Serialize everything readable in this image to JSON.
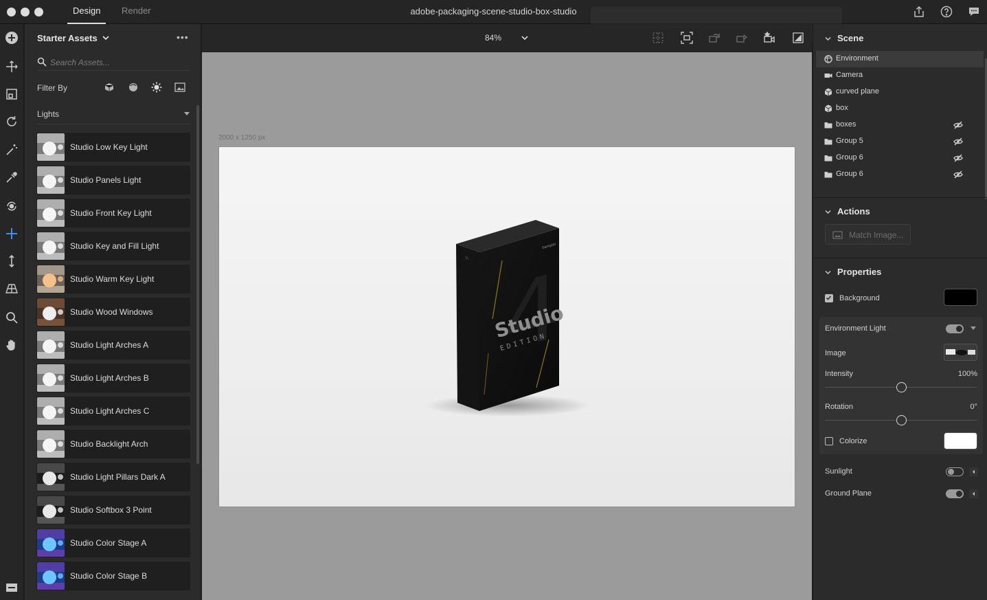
{
  "title_bar": {
    "tabs": [
      "Design",
      "Render"
    ],
    "document_title": "adobe-packaging-scene-studio-box-studio",
    "icons": [
      "share-icon",
      "help-icon",
      "feedback-icon"
    ]
  },
  "tools": [
    "add-icon",
    "move-icon",
    "frame-icon",
    "rotate-icon",
    "magic-wand-icon",
    "eyedropper-icon",
    "orbit-icon",
    "crosshair-move-icon",
    "vertical-move-icon",
    "perspective-icon",
    "zoom-icon",
    "hand-icon",
    "panel-toggle-icon"
  ],
  "assets": {
    "header": "Starter Assets",
    "more": "•••",
    "search_placeholder": "Search Assets...",
    "filter_label": "Filter By",
    "category": "Lights",
    "items": [
      {
        "label": "Studio Low Key Light",
        "thumb": "gray"
      },
      {
        "label": "Studio Panels Light",
        "thumb": "gray"
      },
      {
        "label": "Studio Front Key Light",
        "thumb": "gray"
      },
      {
        "label": "Studio Key and Fill Light",
        "thumb": "gray"
      },
      {
        "label": "Studio Warm Key Light",
        "thumb": "warm"
      },
      {
        "label": "Studio Wood Windows",
        "thumb": "wood"
      },
      {
        "label": "Studio Light Arches A",
        "thumb": "gray"
      },
      {
        "label": "Studio Light Arches B",
        "thumb": "gray"
      },
      {
        "label": "Studio Light Arches C",
        "thumb": "gray"
      },
      {
        "label": "Studio Backlight Arch",
        "thumb": "gray"
      },
      {
        "label": "Studio Light Pillars Dark A",
        "thumb": "dark"
      },
      {
        "label": "Studio Softbox 3 Point",
        "thumb": "dark"
      },
      {
        "label": "Studio Color Stage A",
        "thumb": "color"
      },
      {
        "label": "Studio Color Stage B",
        "thumb": "color"
      }
    ]
  },
  "canvas": {
    "zoom": "84%",
    "dimensions": "2000 x 1250 px",
    "box_text": {
      "brand": "Sampler",
      "headline": "Studio",
      "subline": "EDITION",
      "spine": "SL",
      "big_numeral": "4"
    }
  },
  "scene": {
    "header": "Scene",
    "layers": [
      {
        "label": "Environment",
        "icon": "environment-icon",
        "hidden": false,
        "selected": true
      },
      {
        "label": "Camera",
        "icon": "camera-icon",
        "hidden": false,
        "selected": false
      },
      {
        "label": "curved plane",
        "icon": "model-icon",
        "hidden": false,
        "selected": false
      },
      {
        "label": "box",
        "icon": "model-icon",
        "hidden": false,
        "selected": false
      },
      {
        "label": "boxes",
        "icon": "folder-icon",
        "hidden": true,
        "selected": false
      },
      {
        "label": "Group 5",
        "icon": "folder-icon",
        "hidden": true,
        "selected": false
      },
      {
        "label": "Group 6",
        "icon": "folder-icon",
        "hidden": true,
        "selected": false
      },
      {
        "label": "Group 6",
        "icon": "folder-icon",
        "hidden": true,
        "selected": false
      }
    ]
  },
  "actions": {
    "header": "Actions",
    "match_image": "Match Image..."
  },
  "properties": {
    "header": "Properties",
    "background_label": "Background",
    "background_checked": true,
    "background_color": "#000000",
    "env_light_label": "Environment Light",
    "env_light_on": true,
    "image_label": "Image",
    "intensity_label": "Intensity",
    "intensity_value": "100%",
    "intensity_fraction": 0.5,
    "rotation_label": "Rotation",
    "rotation_value": "0°",
    "rotation_fraction": 0.5,
    "colorize_label": "Colorize",
    "colorize_checked": false,
    "colorize_color": "#ffffff",
    "sunlight_label": "Sunlight",
    "sunlight_on": false,
    "ground_plane_label": "Ground Plane",
    "ground_plane_on": true
  },
  "colors": {
    "accent": "#3d8eff",
    "panel": "#2b2b2b",
    "canvas_bg": "#9b9b9b"
  }
}
